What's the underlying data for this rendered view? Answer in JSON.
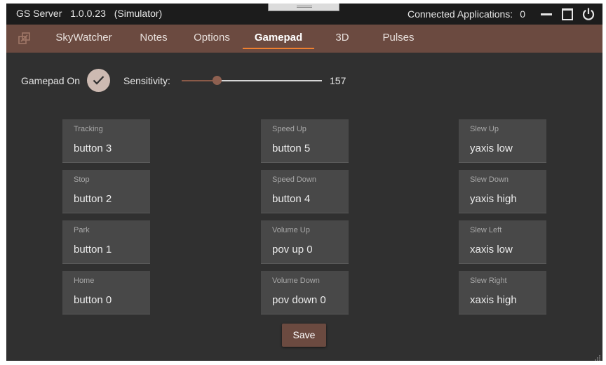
{
  "titlebar": {
    "app_name": "GS Server",
    "version": "1.0.0.23",
    "mode": "(Simulator)",
    "connected_label": "Connected Applications:",
    "connected_count": "0"
  },
  "nav": {
    "tabs": [
      {
        "label": "SkyWatcher"
      },
      {
        "label": "Notes"
      },
      {
        "label": "Options"
      },
      {
        "label": "Gamepad"
      },
      {
        "label": "3D"
      },
      {
        "label": "Pulses"
      }
    ],
    "active": "Gamepad"
  },
  "gamepad": {
    "on_label": "Gamepad On",
    "on_checked": true,
    "sensitivity_label": "Sensitivity:",
    "sensitivity_value": "157",
    "sensitivity_fraction": 0.25
  },
  "mappings": [
    {
      "label": "Tracking",
      "value": "button 3"
    },
    {
      "label": "Stop",
      "value": "button 2"
    },
    {
      "label": "Park",
      "value": "button 1"
    },
    {
      "label": "Home",
      "value": "button 0"
    },
    {
      "label": "Speed Up",
      "value": "button 5"
    },
    {
      "label": "Speed Down",
      "value": "button 4"
    },
    {
      "label": "Volume Up",
      "value": "pov up 0"
    },
    {
      "label": "Volume Down",
      "value": "pov down 0"
    },
    {
      "label": "Slew Up",
      "value": "yaxis low"
    },
    {
      "label": "Slew Down",
      "value": "yaxis high"
    },
    {
      "label": "Slew Left",
      "value": "xaxis low"
    },
    {
      "label": "Slew Right",
      "value": "xaxis high"
    }
  ],
  "save_label": "Save",
  "colors": {
    "accent": "#6b4a40",
    "tab_underline": "#f08030",
    "background": "#303030"
  }
}
